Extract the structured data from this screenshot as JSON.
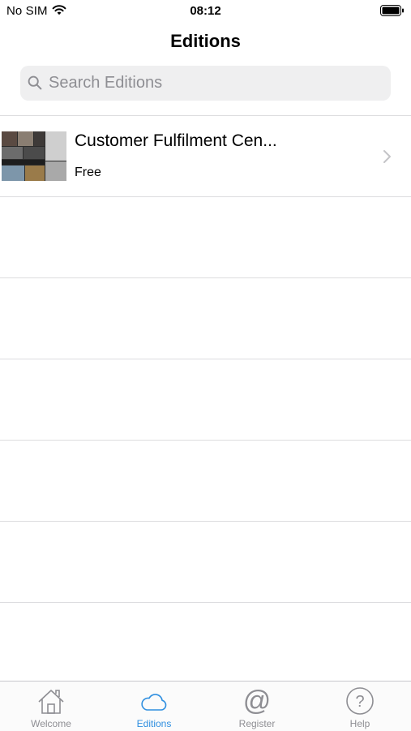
{
  "status_bar": {
    "carrier": "No SIM",
    "time": "08:12"
  },
  "nav": {
    "title": "Editions"
  },
  "search": {
    "placeholder": "Search Editions",
    "value": ""
  },
  "editions": [
    {
      "title": "Customer Fulfilment Cen...",
      "price": "Free"
    }
  ],
  "tab_bar": {
    "active": "Editions",
    "tabs": [
      {
        "label": "Welcome",
        "icon": "home-icon"
      },
      {
        "label": "Editions",
        "icon": "cloud-icon"
      },
      {
        "label": "Register",
        "icon": "at-sign-icon"
      },
      {
        "label": "Help",
        "icon": "question-circle-icon"
      }
    ]
  },
  "colors": {
    "accent": "#2f8fe0",
    "inactive": "#8e8e93",
    "separator": "#dcdcdf",
    "search_background": "#efeff0"
  }
}
